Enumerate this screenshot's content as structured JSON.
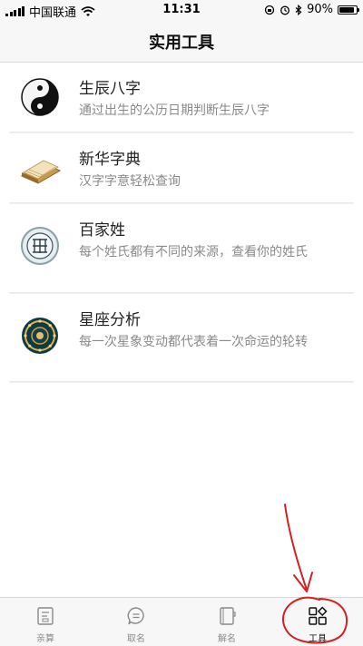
{
  "status_bar": {
    "carrier": "中国联通",
    "time": "11:31",
    "battery": "90%",
    "battery_level": 0.9
  },
  "navbar": {
    "title": "实用工具"
  },
  "tools": [
    {
      "title": "生辰八字",
      "desc": "通过出生的公历日期判断生辰八字",
      "icon": "yin-yang-icon"
    },
    {
      "title": "新华字典",
      "desc": "汉字字意轻松查询",
      "icon": "book-icon"
    },
    {
      "title": "百家姓",
      "desc": "每个姓氏都有不同的来源，查看你的姓氏",
      "icon": "seal-icon"
    },
    {
      "title": "星座分析",
      "desc": "每一次星象变动都代表着一次命运的轮转",
      "icon": "zodiac-wheel-icon"
    }
  ],
  "tabbar": {
    "tabs": [
      {
        "label": "亲算",
        "icon": "document-icon"
      },
      {
        "label": "取名",
        "icon": "chat-bubble-icon"
      },
      {
        "label": "解名",
        "icon": "notebook-icon"
      },
      {
        "label": "工具",
        "icon": "grid-icon",
        "active": true
      }
    ]
  },
  "colors": {
    "annotation_red": "#d42020",
    "description_gray": "#8a8a8a",
    "bar_background": "#f7f7f7"
  }
}
